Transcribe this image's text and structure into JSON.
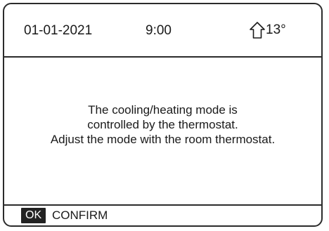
{
  "status_bar": {
    "date": "01-01-2021",
    "time": "9:00",
    "outdoor_icon": "house-outline-icon",
    "outdoor_temp": "13°"
  },
  "message": {
    "line1": "The cooling/heating mode is",
    "line2": "controlled by the thermostat.",
    "line3": "Adjust the mode with the room thermostat."
  },
  "footer": {
    "ok_key": "OK",
    "confirm_label": "CONFIRM"
  }
}
